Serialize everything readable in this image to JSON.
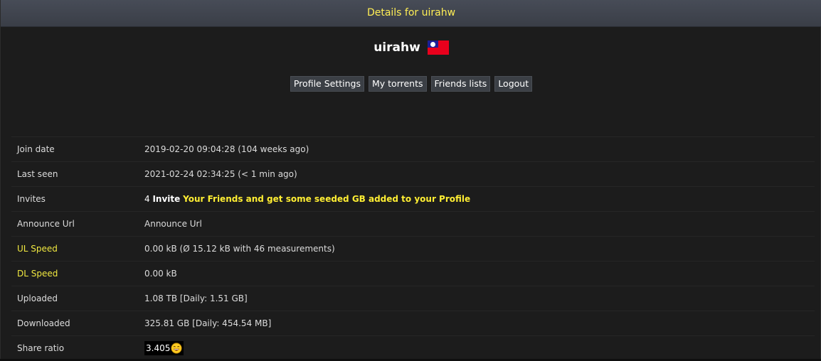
{
  "header": {
    "title": "Details for uirahw"
  },
  "user": {
    "name": "uirahw",
    "flag_icon": "taiwan-flag-icon"
  },
  "nav": {
    "items": [
      {
        "label": "Profile Settings"
      },
      {
        "label": "My torrents"
      },
      {
        "label": "Friends lists"
      },
      {
        "label": "Logout"
      }
    ]
  },
  "details": {
    "join_date": {
      "label": "Join date",
      "value": "2019-02-20 09:04:28 (104 weeks ago)"
    },
    "last_seen": {
      "label": "Last seen",
      "value": "2021-02-24 02:34:25 (< 1 min ago)"
    },
    "invites": {
      "label": "Invites",
      "count": "4",
      "invite_word": "Invite",
      "link_text": "Your Friends and get some seeded GB added to your Profile"
    },
    "announce_url": {
      "label": "Announce Url",
      "value": "Announce Url"
    },
    "ul_speed": {
      "label": "UL Speed",
      "value": "0.00 kB (Ø 15.12 kB with 46 measurements)"
    },
    "dl_speed": {
      "label": "DL Speed",
      "value": "0.00 kB"
    },
    "uploaded": {
      "label": "Uploaded",
      "value": "1.08 TB [Daily: 1.51 GB]"
    },
    "downloaded": {
      "label": "Downloaded",
      "value": "325.81 GB [Daily: 454.54 MB]"
    },
    "share_ratio": {
      "label": "Share ratio",
      "value": "3.405",
      "icon": "laughing-smiley-icon"
    }
  },
  "colors": {
    "accent_yellow": "#ffee33",
    "background": "#1c1c1c",
    "header_bg": "#3a3e47"
  }
}
